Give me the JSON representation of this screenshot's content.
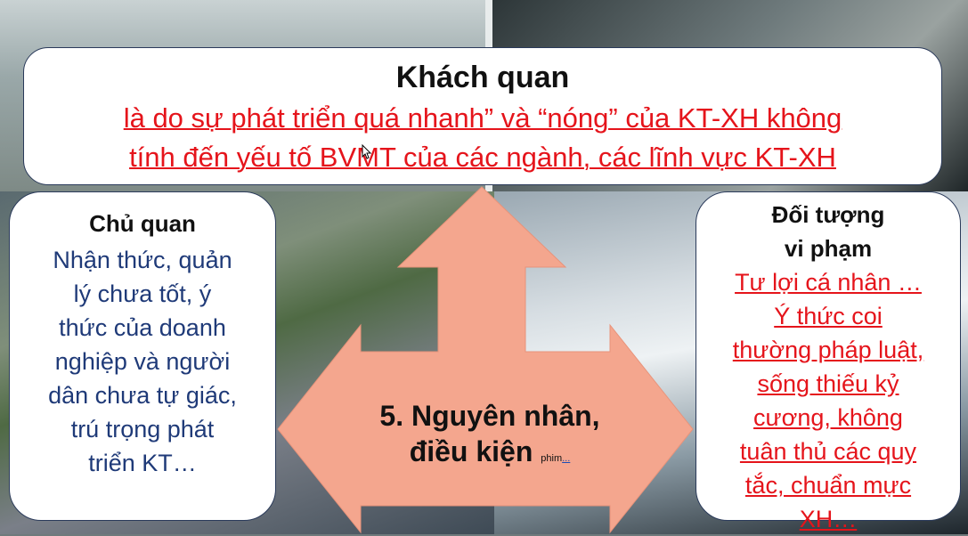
{
  "top": {
    "title": "Khách quan",
    "body_line1": "là do sự phát triển quá nhanh” và “nóng” của KT-XH không",
    "body_line2": "tính đến yếu tố BVMT của các ngành, các lĩnh vực KT-XH"
  },
  "left": {
    "title": "Chủ quan",
    "lines": [
      "Nhận thức, quản",
      "lý chưa tốt, ý",
      "thức của doanh",
      "nghiệp và người",
      "dân chưa tự giác,",
      "trú trọng phát",
      "triển KT…"
    ]
  },
  "right": {
    "title_line1": "Đối tượng",
    "title_line2": "vi phạm",
    "lines": [
      "Tư lợi cá nhân …",
      "Ý thức coi",
      "thường pháp luật,",
      "sống thiếu kỷ",
      "cương, không",
      "tuân thủ các quy",
      "tắc, chuẩn mực",
      "XH…"
    ]
  },
  "center": {
    "line1": "5. Nguyên nhân,",
    "line2": "điều kiện",
    "link_text": "phim",
    "link_suffix": "..."
  },
  "colors": {
    "arrow_fill": "#f4a68e",
    "red_text": "#e5141b",
    "blue_text": "#1f3a78"
  },
  "icons": {
    "cursor": "mouse-pointer-icon",
    "arrow": "three-way-arrow-icon"
  }
}
